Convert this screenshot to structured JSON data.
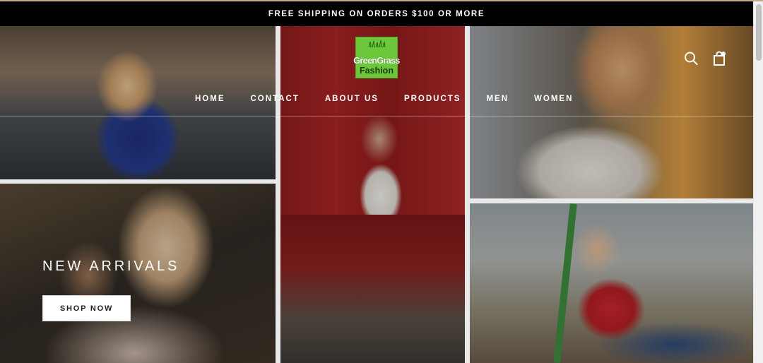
{
  "announcement": {
    "text": "FREE SHIPPING ON ORDERS $100 OR MORE"
  },
  "brand": {
    "logo_line1": "GreenGrass",
    "logo_line2": "Fashion",
    "logo_color": "#6cc83a"
  },
  "nav": {
    "items": [
      {
        "label": "HOME"
      },
      {
        "label": "CONTACT"
      },
      {
        "label": "ABOUT US"
      },
      {
        "label": "PRODUCTS"
      },
      {
        "label": "MEN"
      },
      {
        "label": "WOMEN"
      }
    ]
  },
  "header_icons": {
    "search": "search-icon",
    "cart": "shopping-bag-icon"
  },
  "hero": {
    "title": "NEW ARRIVALS",
    "button_label": "SHOP NOW",
    "tiles": [
      {
        "name": "hero-image-woman-ferris-wheel"
      },
      {
        "name": "hero-image-couple-embrace"
      },
      {
        "name": "hero-image-woman-red-wall"
      },
      {
        "name": "hero-image-man-sunglasses"
      },
      {
        "name": "hero-image-woman-pointing"
      }
    ]
  }
}
